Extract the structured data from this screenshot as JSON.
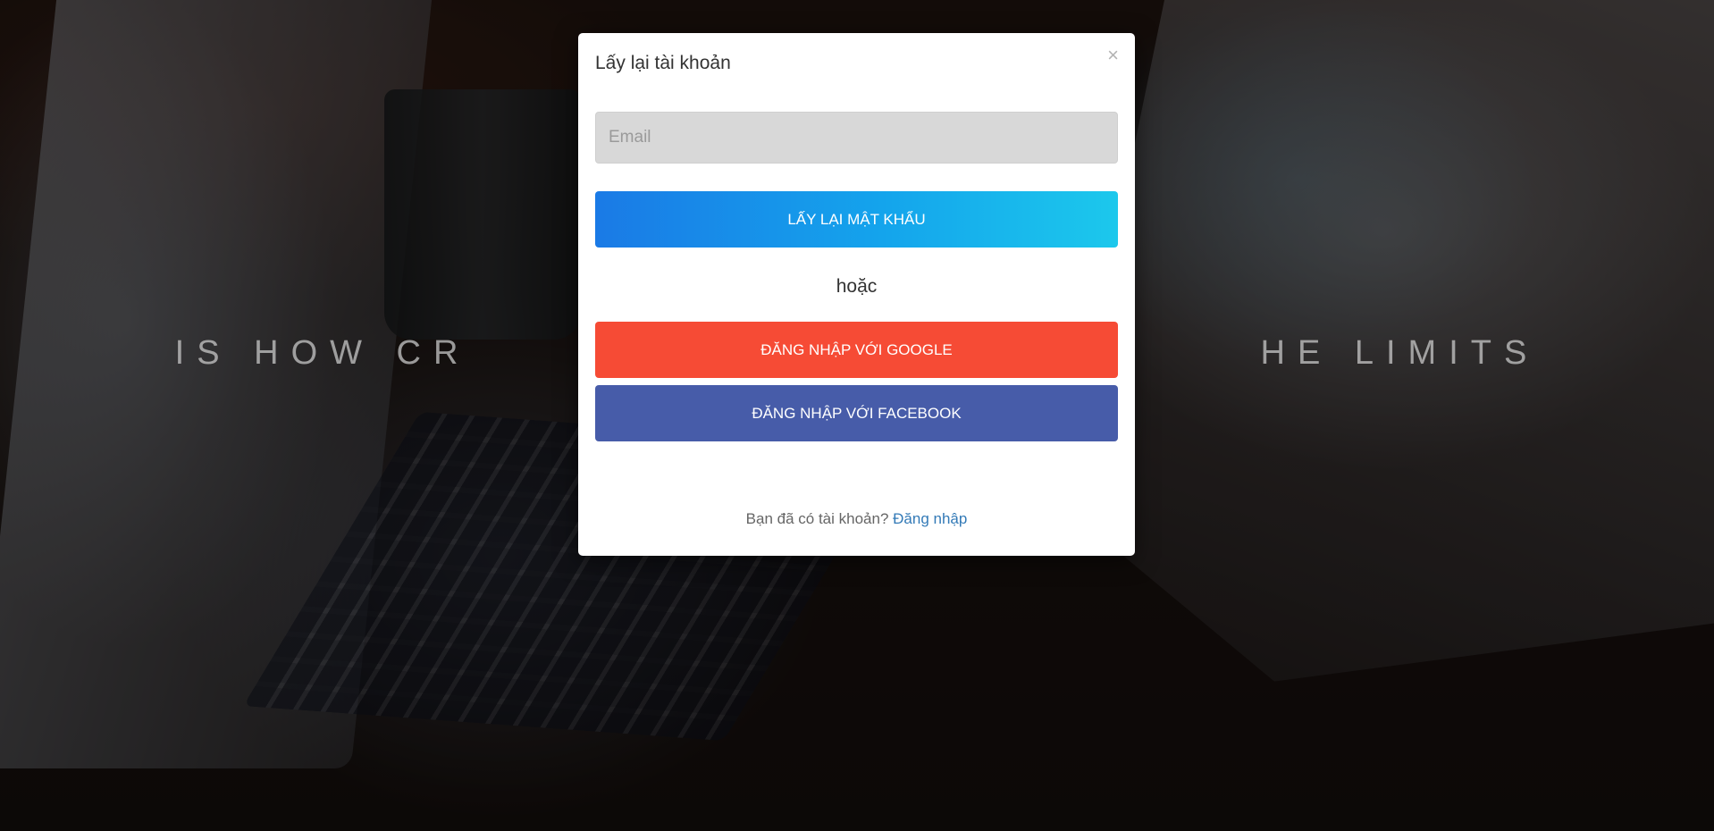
{
  "hero": {
    "tagline": "IS HOW CR                                    HE LIMITS"
  },
  "modal": {
    "title": "Lấy lại tài khoản",
    "close_label": "×",
    "email_placeholder": "Email",
    "email_value": "",
    "recover_button": "LẤY LẠI MẬT KHẨU",
    "or_text": "hoặc",
    "google_button": "ĐĂNG NHẬP VỚI GOOGLE",
    "facebook_button": "ĐĂNG NHẬP VỚI FACEBOOK",
    "footer_text": "Bạn đã có tài khoản?",
    "login_link": "Đăng nhập"
  },
  "colors": {
    "recover_gradient_start": "#1a7ae6",
    "recover_gradient_end": "#1cc8ec",
    "google": "#f64b35",
    "facebook": "#475ca9",
    "link": "#337ab7"
  },
  "icons": {
    "close": "close-icon"
  }
}
